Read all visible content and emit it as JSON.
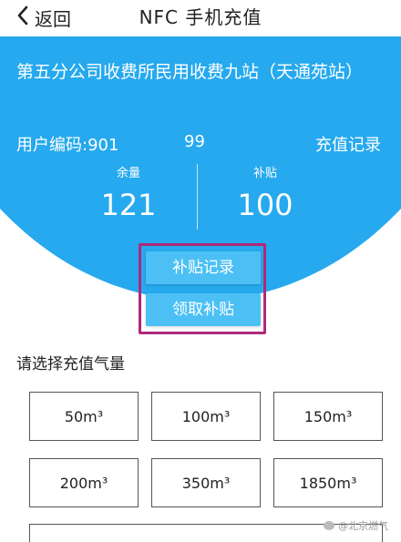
{
  "header": {
    "back_label": "返回",
    "title": "NFC 手机充值"
  },
  "hero": {
    "station_name": "第五分公司收费所民用收费九站（天通苑站）",
    "user_label": "用户编码:901",
    "user_number_tail": "99",
    "history_link": "充值记录",
    "balance_label": "余量",
    "balance_value": "121",
    "subsidy_label": "补贴",
    "subsidy_value": "100"
  },
  "actions": {
    "subsidy_records": "补贴记录",
    "claim_subsidy": "领取补贴"
  },
  "recharge": {
    "section_label": "请选择充值气量",
    "options": [
      "50m³",
      "100m³",
      "150m³",
      "200m³",
      "350m³",
      "1850m³"
    ]
  },
  "watermark": {
    "text": "@北京燃气"
  },
  "colors": {
    "hero_blue": "#26a9ee",
    "pill_blue": "#4cc0f5",
    "highlight_border": "#b0287a"
  },
  "icons": {
    "back": "chevron-left-icon"
  }
}
